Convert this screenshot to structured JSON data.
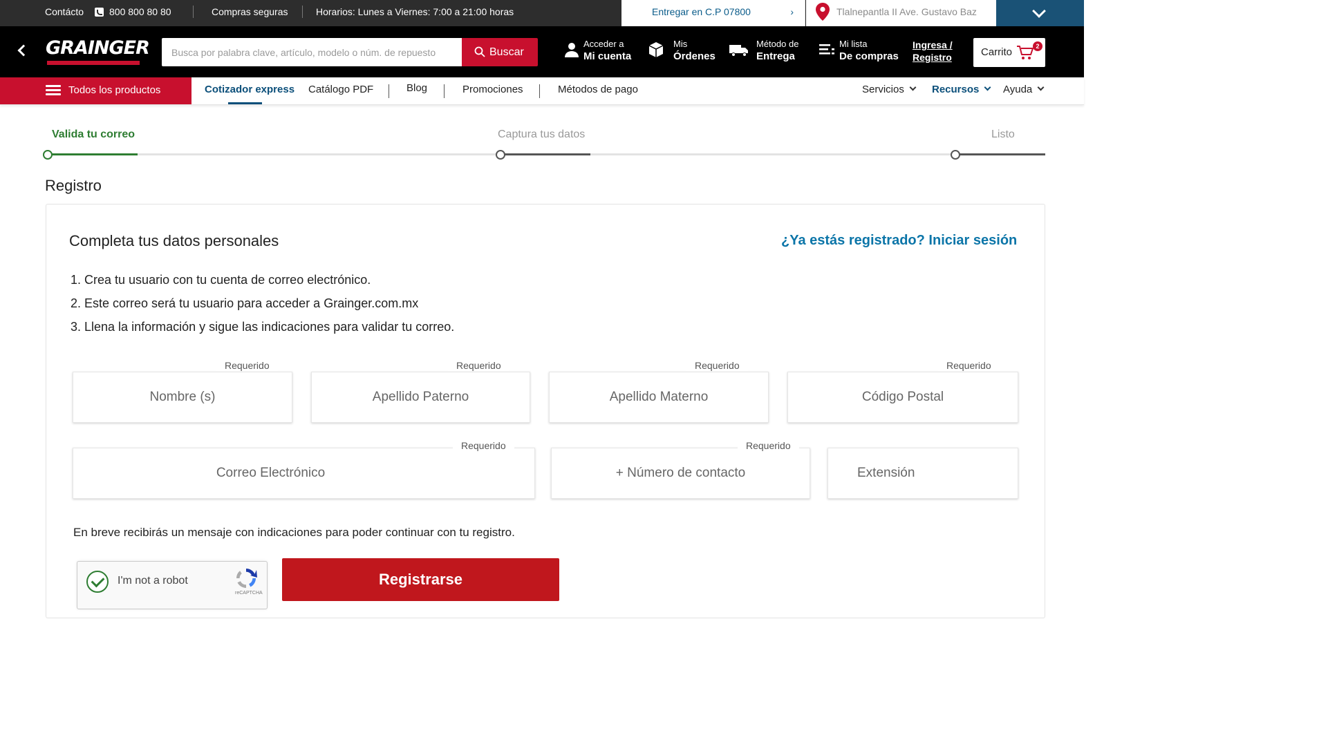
{
  "topbar": {
    "contact_label": "Contácto",
    "phone": "800 800 80 80",
    "secure": "Compras seguras",
    "hours": "Horarios: Lunes a Viernes: 7:00 a 21:00 horas",
    "deliver": "Entregar en C.P 07800",
    "location": "Tlalnepantla II  Ave. Gustavo Baz"
  },
  "header": {
    "logo": "GRAINGER",
    "search_placeholder": "Busca por palabra clave, artículo, modelo o núm. de repuesto",
    "search_button": "Buscar",
    "account": {
      "line1": "Acceder a",
      "line2": "Mi cuenta"
    },
    "orders": {
      "line1": "Mis",
      "line2": "Órdenes"
    },
    "delivery": {
      "line1": "Método de",
      "line2": "Entrega"
    },
    "list": {
      "line1": "Mi lista",
      "line2": "De compras"
    },
    "login": {
      "line1": "Ingresa /",
      "line2": "Registro"
    },
    "cart_label": "Carrito",
    "cart_count": "2"
  },
  "nav": {
    "all_products": "Todos los productos",
    "links": [
      "Cotizador express",
      "Catálogo PDF",
      "Blog",
      "Promociones",
      "Métodos de pago"
    ],
    "right": [
      "Servicios",
      "Recursos",
      "Ayuda"
    ]
  },
  "stepper": {
    "steps": [
      "Valida tu correo",
      "Captura tus datos",
      "Listo"
    ]
  },
  "page": {
    "section_title": "Registro",
    "card_title": "Completa tus datos personales",
    "login_prompt": "¿Ya estás registrado? Iniciar sesión",
    "instructions": [
      "1. Crea tu usuario con tu cuenta de correo electrónico.",
      "2. Este correo será tu usuario para acceder a Grainger.com.mx",
      "3. Llena la información y sigue las indicaciones para validar tu correo."
    ],
    "required_label": "Requerido",
    "fields": {
      "nombre": "Nombre (s)",
      "apellido_paterno": "Apellido Paterno",
      "apellido_materno": "Apellido Materno",
      "codigo_postal": "Código Postal",
      "correo": "Correo Electrónico",
      "telefono": "+ Número de contacto",
      "extension": "Extensión"
    },
    "notice": "En breve recibirás un mensaje con indicaciones para poder continuar con tu registro.",
    "captcha_text": "I'm not a robot",
    "captcha_brand": "reCAPTCHA",
    "register_button": "Registrarse"
  },
  "colors": {
    "brand_red": "#c8102e",
    "link_blue": "#0b75a8",
    "nav_active": "#0b4f7a",
    "step_done": "#2e7d32"
  },
  "icons": [
    "phone-icon",
    "chevron-right-icon",
    "location-pin-icon",
    "chevron-down-icon",
    "back-chevron-icon",
    "search-icon",
    "user-icon",
    "box-icon",
    "truck-icon",
    "list-icon",
    "cart-icon",
    "hamburger-icon",
    "check-icon",
    "recaptcha-icon"
  ]
}
